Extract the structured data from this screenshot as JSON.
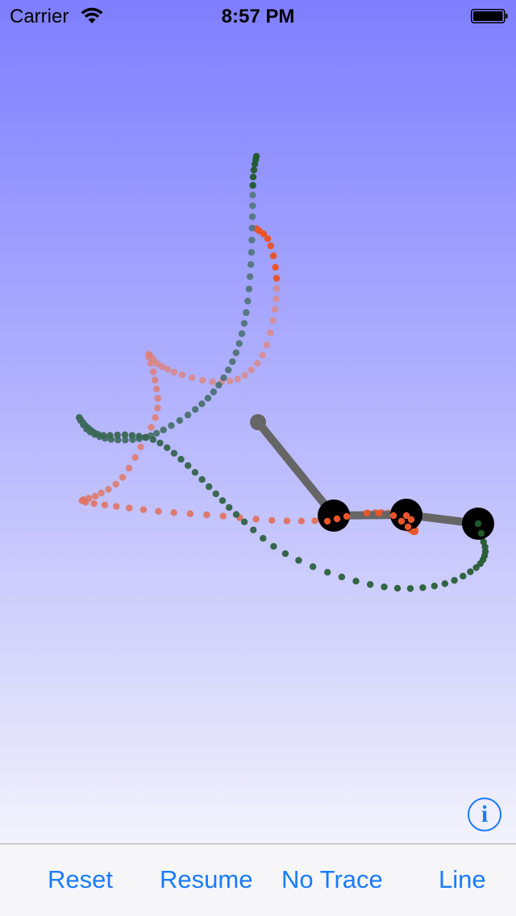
{
  "status_bar": {
    "carrier": "Carrier",
    "time": "8:57 PM",
    "wifi_icon": "wifi-icon",
    "battery_icon": "battery-icon",
    "battery_level": 1.0
  },
  "scene": {
    "description": "triple pendulum simulation with motion traces",
    "colors": {
      "background_top": "#7f7fff",
      "background_bottom": "#f5f5ff",
      "rod": "#666666",
      "bob": "#000000",
      "trace_middle": "#e8552a",
      "trace_end": "#1f5a2a"
    }
  },
  "info_button": {
    "icon": "info-icon",
    "label": "i"
  },
  "toolbar": {
    "reset_label": "Reset",
    "resume_label": "Resume",
    "trace_label": "No Trace",
    "line_label": "Line",
    "tint": "#1a7bff"
  }
}
